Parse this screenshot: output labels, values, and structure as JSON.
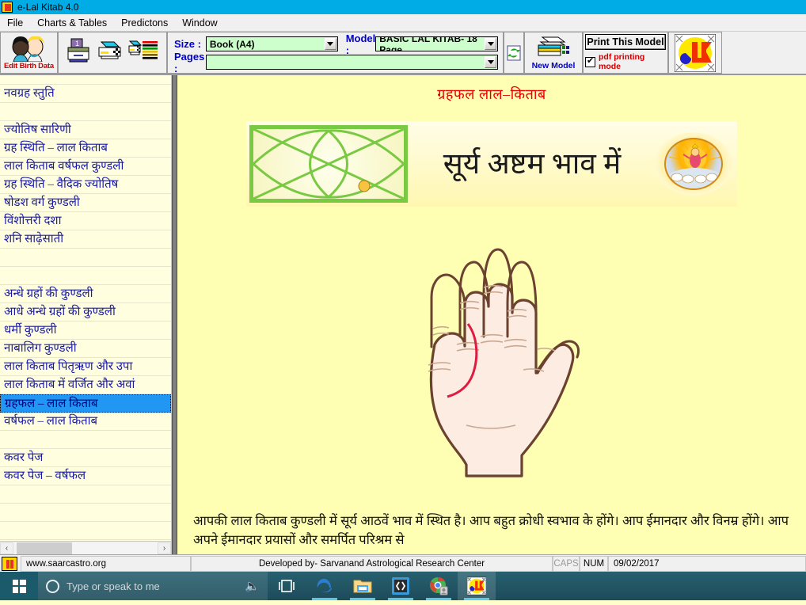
{
  "window": {
    "title": "e-Lal Kitab 4.0",
    "icon": "lal-kitab-logo-icon"
  },
  "menubar": {
    "items": [
      {
        "label": "File"
      },
      {
        "label": "Charts & Tables"
      },
      {
        "label": "Predictons"
      },
      {
        "label": "Window"
      }
    ]
  },
  "toolbar": {
    "edit_birth_data_label": "Edit Birth Data",
    "size_label": "Size :",
    "pages_label": "Pages :",
    "model_label": "Model :",
    "size_value": "Book (A4)",
    "pages_value": "",
    "model_value": "BASIC LAL KITAB- 18 Page",
    "new_model_label": "New Model",
    "print_this_model_label": "Print This Model",
    "pdf_printing_mode_label": "pdf printing mode",
    "pdf_printing_mode_checked": true,
    "icons": {
      "printer": "printer-icon",
      "print_preview": "print-preview-icon",
      "color_bars": "color-bars-icon",
      "refresh": "refresh-icon",
      "new_model_printer": "printer-color-icon",
      "brand_logo": "elk-logo-icon"
    }
  },
  "sidebar": {
    "items": [
      {
        "label": "",
        "type": "blank"
      },
      {
        "label": "नवग्रह स्तुति",
        "type": "item"
      },
      {
        "label": "",
        "type": "blank"
      },
      {
        "label": "ज्योतिष सारिणी",
        "type": "item"
      },
      {
        "label": "ग्रह स्थिति – लाल किताब",
        "type": "item"
      },
      {
        "label": "लाल किताब वर्षफल कुण्डली",
        "type": "item"
      },
      {
        "label": "ग्रह स्थिति – वैदिक ज्योतिष",
        "type": "item"
      },
      {
        "label": "षोडश वर्ग कुण्डली",
        "type": "item"
      },
      {
        "label": "विंशोत्तरी दशा",
        "type": "item"
      },
      {
        "label": "शनि साढ़ेसाती",
        "type": "item"
      },
      {
        "label": "",
        "type": "blank"
      },
      {
        "label": "",
        "type": "blank"
      },
      {
        "label": "अन्धे ग्रहों की कुण्डली",
        "type": "item"
      },
      {
        "label": "आधे अन्धे ग्रहों की कुण्डली",
        "type": "item"
      },
      {
        "label": "धर्मी कुण्डली",
        "type": "item"
      },
      {
        "label": "नाबालिग कुण्डली",
        "type": "item"
      },
      {
        "label": "लाल किताब पितृऋण और उपा",
        "type": "item"
      },
      {
        "label": "लाल किताब में वर्जित और अवां",
        "type": "item"
      },
      {
        "label": "ग्रहफल – लाल किताब",
        "type": "selected"
      },
      {
        "label": "वर्षफल – लाल किताब",
        "type": "item"
      },
      {
        "label": "",
        "type": "blank"
      },
      {
        "label": "कवर पेज",
        "type": "item"
      },
      {
        "label": "कवर पेज – वर्षफल",
        "type": "item"
      },
      {
        "label": "",
        "type": "blank"
      },
      {
        "label": "",
        "type": "blank"
      },
      {
        "label": "",
        "type": "blank"
      },
      {
        "label": "",
        "type": "blank"
      },
      {
        "label": "",
        "type": "blank"
      }
    ],
    "scroll_left_icon": "chevron-left-icon",
    "scroll_right_icon": "chevron-right-icon"
  },
  "content": {
    "doc_title": "ग्रहफल लाल–किताब",
    "banner_heading": "सूर्य अष्टम भाव में",
    "kundli_chart_alt": "north-indian-kundli-chart",
    "sun_deity_alt": "surya-deity-icon",
    "hand_diagram_alt": "palm-hand-diagram",
    "paragraph": "आपकी लाल किताब कुण्डली में सूर्य आठवें भाव में स्थित है। आप बहुत क्रोधी स्वभाव के होंगे। आप ईमानदार और विनम्र होंगे। आप अपने ईमानदार प्रयासों और समर्पित परिश्रम से"
  },
  "statusbar": {
    "website": "www.saarcastro.org",
    "developer": "Developed by- Sarvanand Astrological Research Center",
    "caps": "CAPS",
    "num": "NUM",
    "date": "09/02/2017"
  },
  "taskbar": {
    "start_icon": "windows-start-icon",
    "search_placeholder": "Type or speak to me",
    "mic_icon": "microphone-icon",
    "icons": [
      {
        "name": "task-view-icon"
      },
      {
        "name": "edge-browser-icon"
      },
      {
        "name": "file-explorer-icon"
      },
      {
        "name": "brackets-editor-icon"
      },
      {
        "name": "chrome-browser-icon"
      },
      {
        "name": "lal-kitab-app-icon"
      }
    ]
  },
  "colors": {
    "titlebar": "#00ace6",
    "selection": "#2196f3",
    "accent_red": "#cc0000",
    "accent_blue": "#0000cc",
    "paper": "#ffffb3",
    "combo_green": "#ccffcc"
  }
}
